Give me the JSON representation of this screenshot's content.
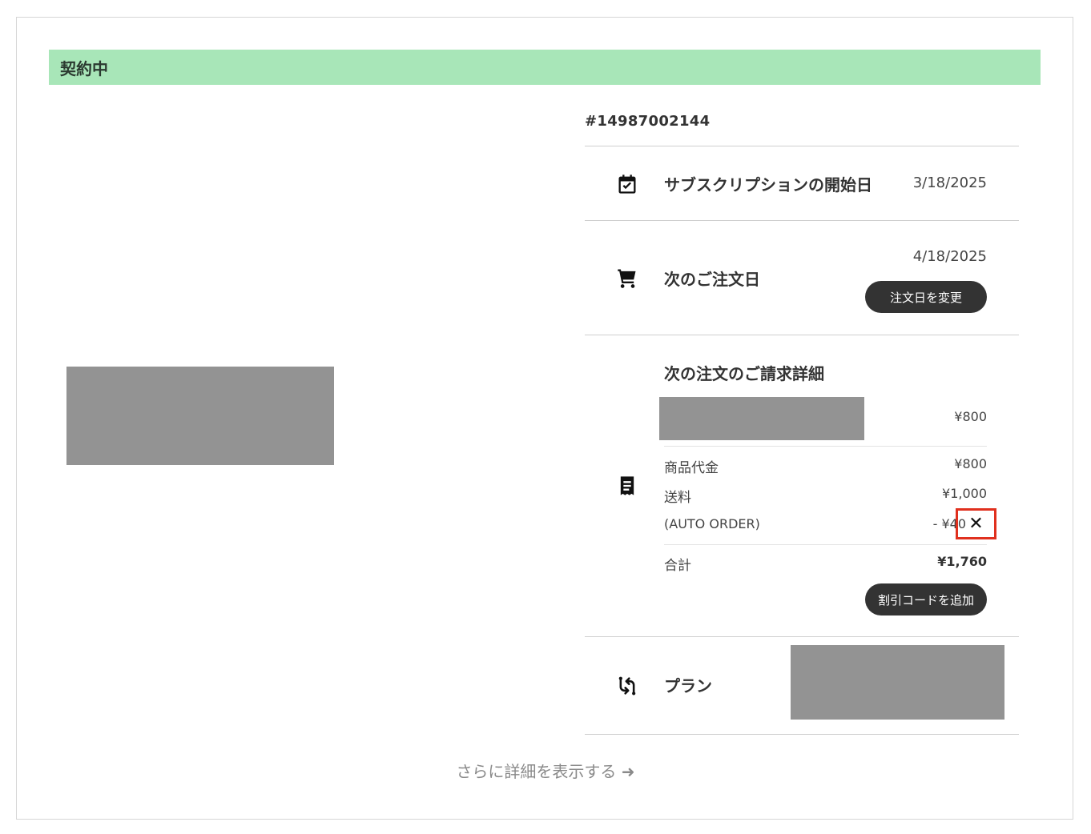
{
  "status": {
    "label": "契約中",
    "color": "#a8e6b8"
  },
  "order": {
    "number": "#14987002144"
  },
  "start_date": {
    "icon": "calendar-check-icon",
    "label": "サブスクリプションの開始日",
    "value": "3/18/2025"
  },
  "next_order": {
    "icon": "cart-icon",
    "label": "次のご注文日",
    "value": "4/18/2025",
    "button": "注文日を変更"
  },
  "billing": {
    "icon": "receipt-icon",
    "title": "次の注文のご請求詳細",
    "product_price": "¥800",
    "lines": [
      {
        "label": "商品代金",
        "value": "¥800"
      },
      {
        "label": "送料",
        "value": "¥1,000"
      },
      {
        "label": "(AUTO ORDER)",
        "value": "- ¥40"
      }
    ],
    "remove_symbol": "✕",
    "total_label": "合計",
    "total_value": "¥1,760",
    "discount_button": "割引コードを追加"
  },
  "plan": {
    "icon": "swap-arrows-icon",
    "label": "プラン"
  },
  "more_link": "さらに詳細を表示する ➜"
}
